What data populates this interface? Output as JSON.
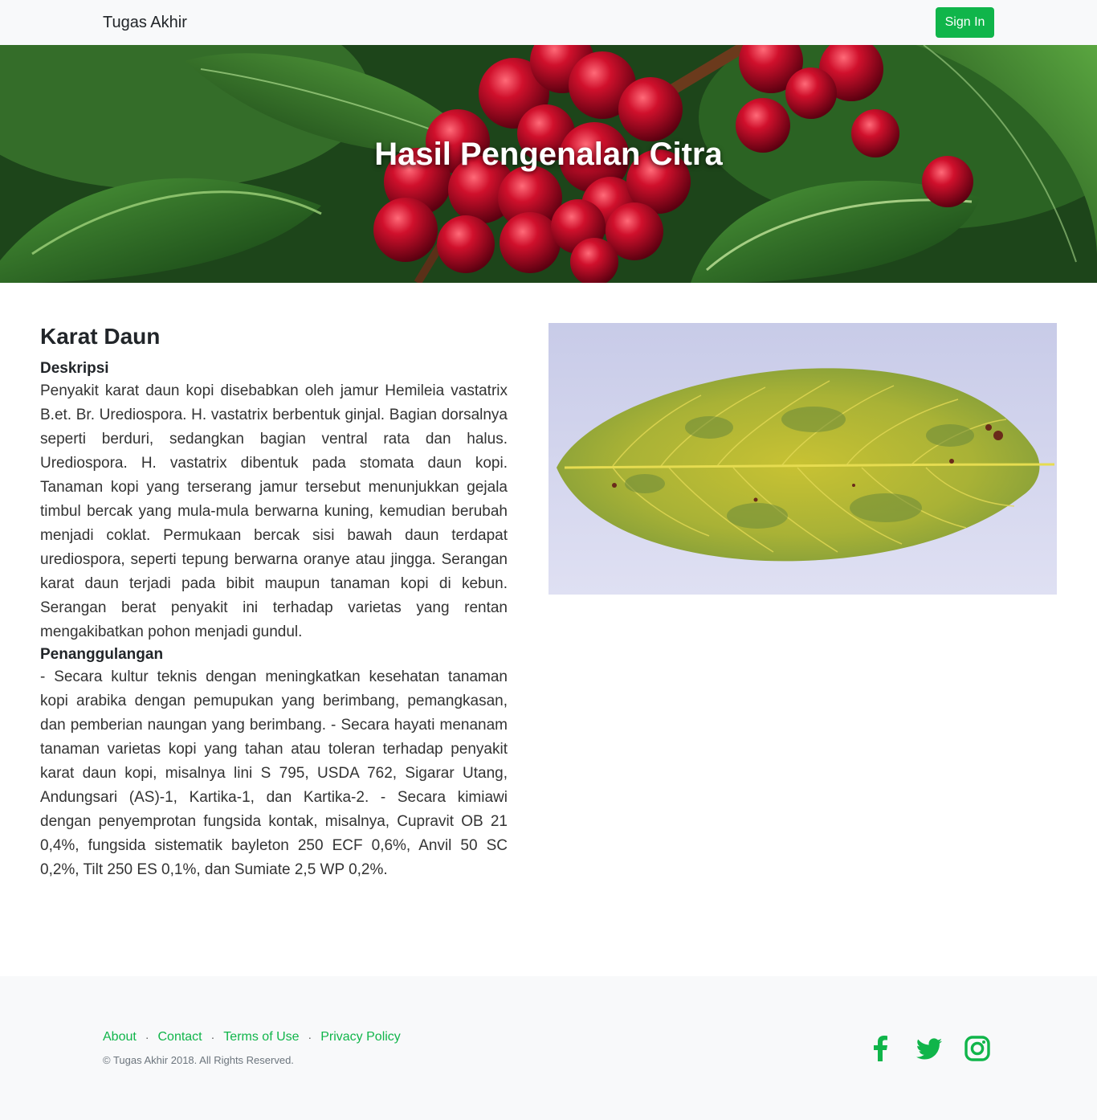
{
  "navbar": {
    "brand": "Tugas Akhir",
    "signin_label": "Sign In"
  },
  "hero": {
    "title": "Hasil Pengenalan Citra"
  },
  "result": {
    "name": "Karat Daun",
    "description_heading": "Deskripsi",
    "description": "Penyakit karat daun kopi disebabkan oleh jamur Hemileia vastatrix B.et. Br. Urediospora. H. vastatrix berbentuk ginjal. Bagian dorsalnya seperti berduri, sedangkan bagian ventral rata dan halus. Urediospora. H. vastatrix dibentuk pada stomata daun kopi. Tanaman kopi yang terserang jamur tersebut menunjukkan gejala timbul bercak yang mula-mula berwarna kuning, kemudian berubah menjadi coklat. Permukaan bercak sisi bawah daun terdapat urediospora, seperti tepung berwarna oranye atau jingga. Serangan karat daun terjadi pada bibit maupun tanaman kopi di kebun. Serangan berat penyakit ini terhadap varietas yang rentan mengakibatkan pohon menjadi gundul.",
    "treatment_heading": "Penanggulangan",
    "treatment": "- Secara kultur teknis dengan meningkatkan kesehatan tanaman kopi arabika dengan pemupukan yang berimbang, pemangkasan, dan pemberian naungan yang berimbang. - Secara hayati menanam tanaman varietas kopi yang tahan atau toleran terhadap penyakit karat daun kopi, misalnya lini S 795, USDA 762, Sigarar Utang, Andungsari (AS)-1, Kartika-1, dan Kartika-2. - Secara kimiawi dengan penyemprotan fungsida kontak, misalnya, Cupravit OB 21 0,4%, fungsida sistematik bayleton 250 ECF 0,6%, Anvil 50 SC 0,2%, Tilt 250 ES 0,1%, dan Sumiate 2,5 WP 0,2%."
  },
  "footer": {
    "links": [
      "About",
      "Contact",
      "Terms of Use",
      "Privacy Policy"
    ],
    "separator": "·",
    "copyright": "© Tugas Akhir 2018. All Rights Reserved.",
    "social_icons": [
      "facebook-icon",
      "twitter-icon",
      "instagram-icon"
    ]
  },
  "colors": {
    "accent": "#10b54a",
    "navbar_bg": "#f8f9fa",
    "footer_bg": "#f8f9fa"
  }
}
